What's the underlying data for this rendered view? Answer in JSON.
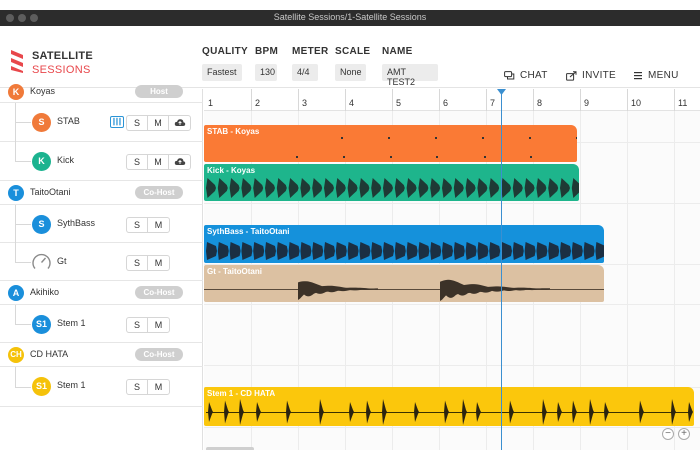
{
  "window": {
    "title": "Satellite Sessions/1-Satellite Sessions"
  },
  "logo": {
    "line1": "SATELLITE",
    "line2": "SESSIONS"
  },
  "settings": [
    {
      "label": "QUALITY",
      "value": "Fastest"
    },
    {
      "label": "BPM",
      "value": "130"
    },
    {
      "label": "METER",
      "value": "4/4"
    },
    {
      "label": "SCALE",
      "value": "None"
    },
    {
      "label": "NAME",
      "value": "AMT TEST2"
    }
  ],
  "actions": {
    "chat": "CHAT",
    "invite": "INVITE",
    "menu": "MENU"
  },
  "ruler": [
    "1",
    "2",
    "3",
    "4",
    "5",
    "6",
    "7",
    "8",
    "9",
    "10",
    "11"
  ],
  "users": [
    {
      "initial": "K",
      "name": "Koyas",
      "role": "Host",
      "color": "#f07a3a",
      "tracks": [
        {
          "initial": "S",
          "name": "STAB",
          "color": "#f07a3a"
        },
        {
          "initial": "K",
          "name": "Kick",
          "color": "#1bb38f"
        }
      ]
    },
    {
      "initial": "T",
      "name": "TaitoOtani",
      "role": "Co-Host",
      "color": "#1a8fdb",
      "tracks": [
        {
          "initial": "S",
          "name": "SythBass",
          "color": "#1a8fdb"
        },
        {
          "initial": "",
          "name": "Gt",
          "color": "#888888"
        }
      ]
    },
    {
      "initial": "A",
      "name": "Akihiko",
      "role": "Co-Host",
      "color": "#1a8fdb",
      "tracks": [
        {
          "initial": "S1",
          "name": "Stem 1",
          "color": "#1a8fdb"
        }
      ]
    },
    {
      "initial": "CH",
      "name": "CD HATA",
      "role": "Co-Host",
      "color": "#f5c20a",
      "tracks": [
        {
          "initial": "S1",
          "name": "Stem 1",
          "color": "#f5c20a"
        }
      ]
    }
  ],
  "controls": {
    "solo": "S",
    "mute": "M"
  },
  "clips": [
    {
      "title": "STAB - Koyas",
      "color": "#fa7a35"
    },
    {
      "title": "Kick - Koyas",
      "color": "#1eb58c"
    },
    {
      "title": "SythBass - TaitoOtani",
      "color": "#1591db"
    },
    {
      "title": "Gt - TaitoOtani",
      "color": "#dcc1a2"
    },
    {
      "title": "Stem 1 - CD HATA",
      "color": "#fbc70c"
    }
  ],
  "zoom": {
    "out": "−",
    "in": "+"
  },
  "icons": [
    "satellite-logo-icon",
    "chat-icon",
    "invite-icon",
    "menu-icon",
    "keyboard-icon",
    "cloud-upload-icon",
    "knob-icon",
    "playhead-icon"
  ]
}
